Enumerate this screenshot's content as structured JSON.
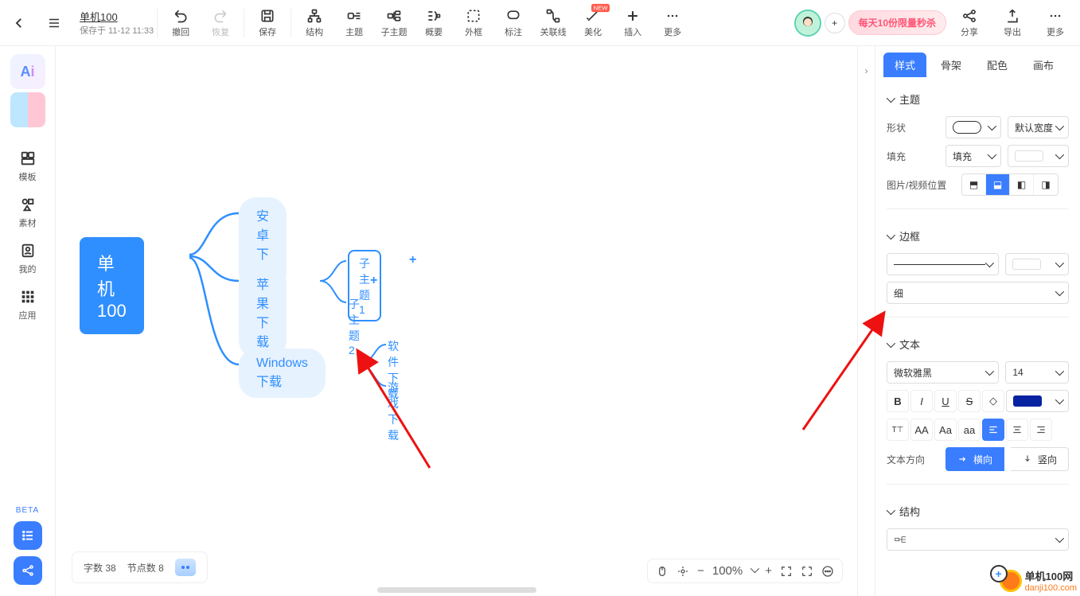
{
  "header": {
    "title": "单机100",
    "saved": "保存于 11-12 11:33",
    "undo": "撤回",
    "redo": "恢复",
    "save": "保存",
    "tools": {
      "structure": "结构",
      "theme": "主题",
      "subtopic": "子主题",
      "summary": "概要",
      "boundary": "外框",
      "note": "标注",
      "relation": "关联线",
      "beautify": "美化",
      "insert": "插入",
      "more": "更多"
    },
    "promo": "每天10份限量秒杀",
    "right": {
      "share": "分享",
      "export": "导出",
      "more": "更多"
    },
    "new_badge": "NEW"
  },
  "leftbar": {
    "template": "模板",
    "material": "素材",
    "mine": "我的",
    "apps": "应用",
    "beta": "BETA"
  },
  "mindmap": {
    "root": "单机100",
    "n1": "安卓下载",
    "n2": "苹果下载",
    "n3": "Windows下载",
    "n2a": "子主题 1",
    "n2b": "子主题 2",
    "n3a": "软件下载",
    "n3b": "游戏下载"
  },
  "status": {
    "words_label": "字数",
    "words": "38",
    "nodes_label": "节点数",
    "nodes": "8"
  },
  "zoom": {
    "value": "100%"
  },
  "right_panel": {
    "tabs": {
      "style": "样式",
      "skeleton": "骨架",
      "color": "配色",
      "canvas": "画布"
    },
    "topic": {
      "head": "主题",
      "shape_label": "形状",
      "width_label": "默认宽度",
      "fill_label": "填充",
      "fill_value": "填充",
      "media_pos": "图片/视频位置"
    },
    "border": {
      "head": "边框",
      "thickness": "细"
    },
    "text": {
      "head": "文本",
      "font": "微软雅黑",
      "size": "14",
      "dir_label": "文本方向",
      "horiz": "横向",
      "vert": "竖向"
    },
    "structure": {
      "head": "结构"
    }
  },
  "watermark": {
    "site": "单机100网",
    "url": "danji100.com"
  }
}
